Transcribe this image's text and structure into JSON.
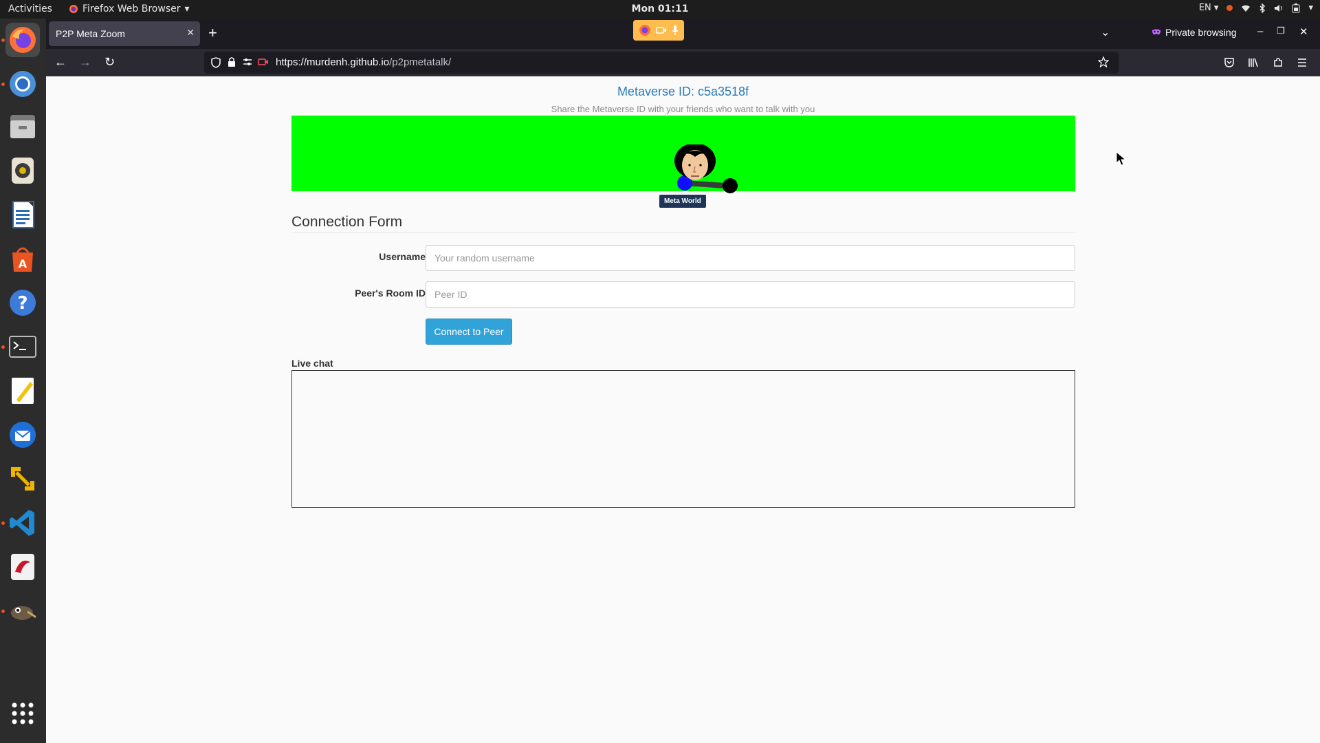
{
  "system": {
    "activities": "Activities",
    "app_menu": "Firefox Web Browser",
    "clock": "Mon 01:11",
    "lang": "EN"
  },
  "dock": {
    "items": [
      "firefox-icon",
      "chromium-icon",
      "files-icon",
      "rhythmbox-icon",
      "writer-icon",
      "software-center-icon",
      "help-icon",
      "terminal-icon",
      "text-editor-icon",
      "thunderbird-icon",
      "vm-icon",
      "vscode-icon",
      "evince-icon",
      "gimp-icon",
      "app-grid-icon"
    ]
  },
  "browser": {
    "tab_title": "P2P Meta Zoom",
    "private_label": "Private browsing",
    "url_host": "https://murdenh.github.io",
    "url_path": "/p2pmetatalk/"
  },
  "page": {
    "metaverse_id": "Metaverse ID: c5a3518f",
    "subtitle": "Share the Metaverse ID with your friends who want to talk with you",
    "avatar_label": "Meta World",
    "form_title": "Connection Form",
    "username_label": "Username",
    "username_placeholder": "Your random username",
    "room_label": "Peer's Room ID",
    "room_placeholder": "Peer ID",
    "connect_button": "Connect to Peer",
    "chat_label": "Live chat"
  },
  "colors": {
    "scene_bg": "#00ff00",
    "accent_link": "#2a7ab8",
    "button_bg": "#31a3d9",
    "topbar_bg": "#1d1d1d",
    "dock_bg": "#2c2c2c"
  }
}
